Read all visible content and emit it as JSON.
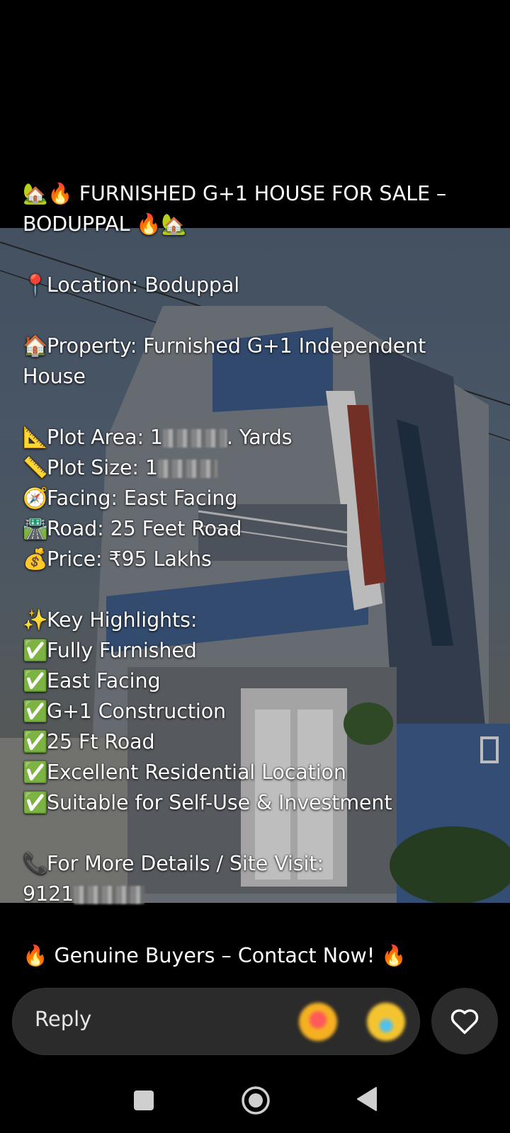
{
  "post": {
    "title_line1": "🏡🔥 FURNISHED G+1 HOUSE FOR SALE –",
    "title_line2": "BODUPPAL 🔥🏡",
    "location": {
      "icon": "📍",
      "text": "Location: Boduppal"
    },
    "property": {
      "icon": "🏠",
      "text_line1": "Property: Furnished G+1 Independent",
      "text_line2": "House"
    },
    "plot_area": {
      "icon": "📐",
      "prefix": "Plot Area: 1",
      "suffix": ". Yards"
    },
    "plot_size": {
      "icon": "📏",
      "prefix": "Plot Size: 1"
    },
    "facing": {
      "icon": "🧭",
      "text": "Facing: East Facing"
    },
    "road": {
      "icon": "🛣️",
      "text": "Road: 25 Feet Road"
    },
    "price": {
      "icon": "💰",
      "text": "Price: ₹95 Lakhs"
    },
    "highlights_header": {
      "icon": "✨",
      "text": "Key Highlights:"
    },
    "highlights": [
      {
        "icon": "✅",
        "text": "Fully Furnished"
      },
      {
        "icon": "✅",
        "text": "East Facing"
      },
      {
        "icon": "✅",
        "text": "G+1 Construction"
      },
      {
        "icon": "✅",
        "text": "25 Ft Road"
      },
      {
        "icon": "✅",
        "text": "Excellent Residential Location"
      },
      {
        "icon": "✅",
        "text": "Suitable for Self-Use & Investment"
      }
    ],
    "contact": {
      "icon": "📞",
      "text": "For More Details / Site Visit:",
      "phone_prefix": "9121"
    },
    "footer": "🔥 Genuine Buyers – Contact Now! 🔥"
  },
  "reply": {
    "placeholder": "Reply",
    "emoji_icons": [
      "heart-eyes-emoji-icon",
      "smiling-emoji-icon"
    ]
  },
  "nav": {
    "icons": [
      "recents-square-icon",
      "home-circle-icon",
      "back-triangle-icon"
    ]
  }
}
